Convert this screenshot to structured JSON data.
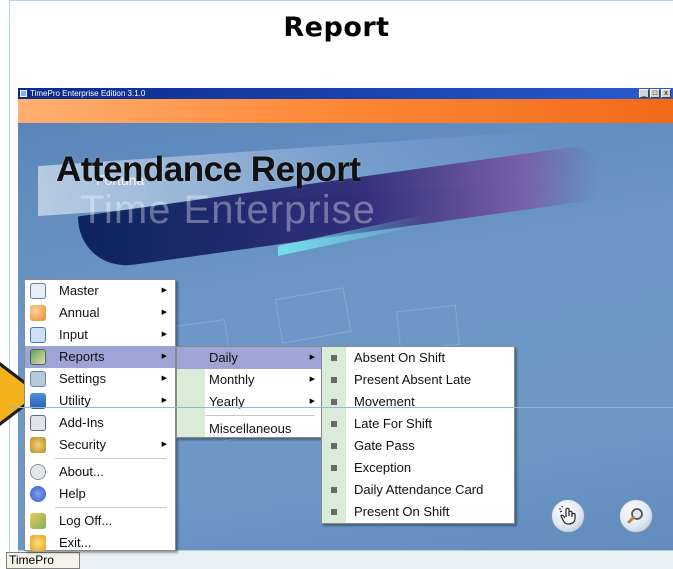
{
  "slide": {
    "title": "Report",
    "overlay_title": "Attendance Report"
  },
  "window": {
    "title": "TimePro Enterprise Edition 3.1.0",
    "buttons": {
      "minimize": "_",
      "maximize": "□",
      "close": "x"
    }
  },
  "banner": {
    "brand_small": "Fortuna",
    "brand_big": "Time Enterprise"
  },
  "start_tab": {
    "label": "TimePro"
  },
  "main_menu": {
    "items": [
      {
        "label": "Master",
        "has_submenu": true,
        "icon": "calendar-icon"
      },
      {
        "label": "Annual",
        "has_submenu": true,
        "icon": "people-icon"
      },
      {
        "label": "Input",
        "has_submenu": true,
        "icon": "input-icon"
      },
      {
        "label": "Reports",
        "has_submenu": true,
        "icon": "reports-icon"
      },
      {
        "label": "Settings",
        "has_submenu": true,
        "icon": "settings-icon"
      },
      {
        "label": "Utility",
        "has_submenu": true,
        "icon": "utility-icon"
      },
      {
        "label": "Add-Ins",
        "has_submenu": false,
        "icon": "addins-icon"
      },
      {
        "label": "Security",
        "has_submenu": true,
        "icon": "security-icon"
      },
      {
        "label": "About...",
        "has_submenu": false,
        "icon": "about-icon"
      },
      {
        "label": "Help",
        "has_submenu": false,
        "icon": "help-icon"
      },
      {
        "label": "Log Off...",
        "has_submenu": false,
        "icon": "logoff-icon"
      },
      {
        "label": "Exit...",
        "has_submenu": false,
        "icon": "exit-icon"
      }
    ]
  },
  "reports_submenu": {
    "items": [
      {
        "label": "Daily",
        "has_submenu": true
      },
      {
        "label": "Monthly",
        "has_submenu": true
      },
      {
        "label": "Yearly",
        "has_submenu": true
      },
      {
        "label": "Miscellaneous",
        "has_submenu": false
      }
    ]
  },
  "daily_submenu": {
    "items": [
      "Absent On Shift",
      "Present Absent Late",
      "Movement",
      "Late For Shift",
      "Gate Pass",
      "Exception",
      "Daily Attendance Card",
      "Present On Shift"
    ]
  },
  "tools": {
    "hand_icon": "hand-pointer-icon",
    "search_icon": "magnifier-icon"
  },
  "colors": {
    "menu_highlight": "#9ea5d6",
    "desktop": "#6d98c6",
    "arrow": "#f2b21b"
  }
}
